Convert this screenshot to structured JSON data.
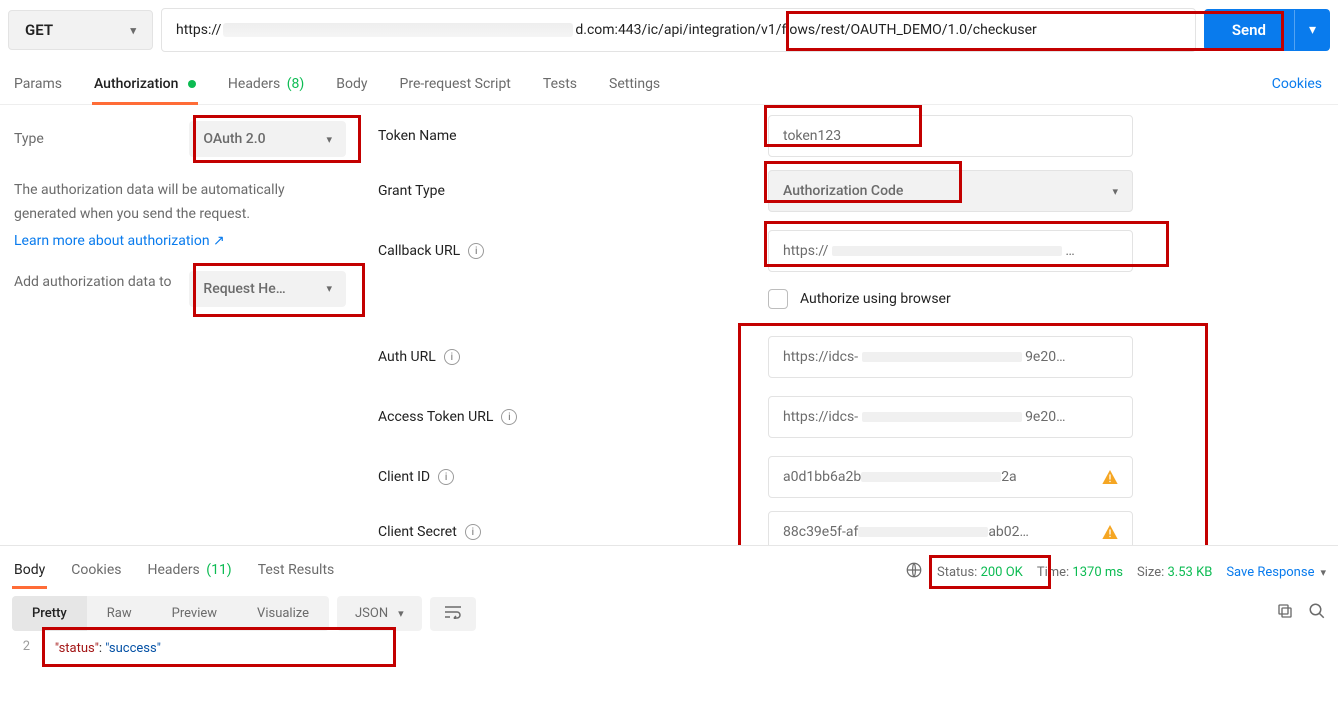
{
  "method": "GET",
  "url_prefix": "https://",
  "url_mid": "d.com:443",
  "url_path": "/ic/api/integration/v1/flows/rest/OAUTH_DEMO/1.0/checkuser",
  "send_label": "Send",
  "tabs": {
    "params": "Params",
    "authorization": "Authorization",
    "headers": "Headers",
    "headers_count": "(8)",
    "body": "Body",
    "prerequest": "Pre-request Script",
    "tests": "Tests",
    "settings": "Settings",
    "cookies": "Cookies"
  },
  "auth": {
    "type_label": "Type",
    "type_value": "OAuth 2.0",
    "help_text": "The authorization data will be automatically generated when you send the request.",
    "learn_more": "Learn more about authorization",
    "add_to_label": "Add authorization data to",
    "add_to_value": "Request He…"
  },
  "form": {
    "token_name_label": "Token Name",
    "token_name_value": "token123",
    "grant_type_label": "Grant Type",
    "grant_type_value": "Authorization Code",
    "callback_label": "Callback URL",
    "callback_value": "https://",
    "authorize_browser": "Authorize using browser",
    "auth_url_label": "Auth URL",
    "auth_url_value_pre": "https://idcs-",
    "auth_url_value_post": "9e20…",
    "access_token_label": "Access Token URL",
    "access_token_value_pre": "https://idcs-",
    "access_token_value_post": "9e20…",
    "client_id_label": "Client ID",
    "client_id_value_pre": "a0d1bb6a2b",
    "client_id_value_post": "2a",
    "client_secret_label": "Client Secret",
    "client_secret_value_pre": "88c39e5f-af",
    "client_secret_value_post": "ab02…"
  },
  "response": {
    "tabs": {
      "body": "Body",
      "cookies": "Cookies",
      "headers": "Headers",
      "headers_count": "(11)",
      "test_results": "Test Results"
    },
    "status_label": "Status:",
    "status_value": "200 OK",
    "time_label": "Time:",
    "time_value": "1370 ms",
    "size_label": "Size:",
    "size_value": "3.53 KB",
    "save_response": "Save Response",
    "views": {
      "pretty": "Pretty",
      "raw": "Raw",
      "preview": "Preview",
      "visualize": "Visualize"
    },
    "format": "JSON",
    "line_num": "2",
    "json_key": "\"status\"",
    "json_value": "\"success\""
  }
}
